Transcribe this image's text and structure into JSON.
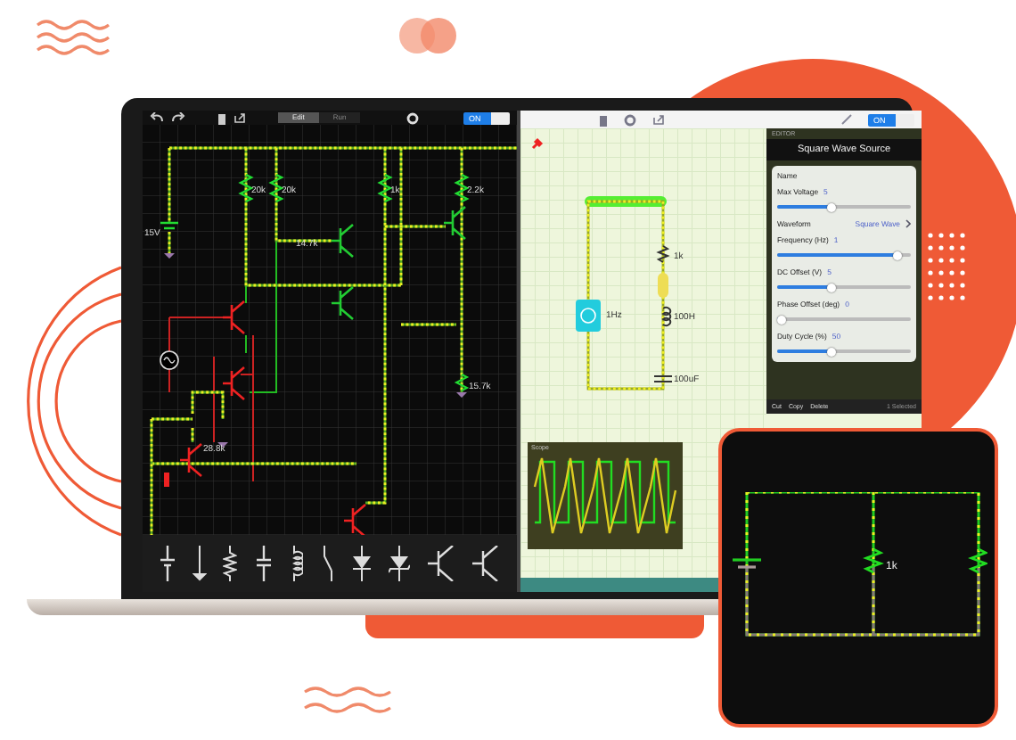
{
  "left_app": {
    "modes": [
      {
        "label": "Edit",
        "selected": true
      },
      {
        "label": "Run",
        "selected": false
      }
    ],
    "power": {
      "label": "ON",
      "on": true
    },
    "component_labels": [
      "20k",
      "20k",
      "1k",
      "2.2k",
      "15V",
      "14.7k",
      "28.8k",
      "15.7k"
    ]
  },
  "right_app": {
    "power": {
      "label": "ON",
      "on": true
    },
    "component_labels": [
      "1k",
      "1Hz",
      "100H",
      "100uF"
    ],
    "scope": {
      "title": "Scope"
    },
    "editor": {
      "header": "EDITOR",
      "title": "Square Wave Source",
      "fields": [
        {
          "kind": "text",
          "label": "Name"
        },
        {
          "kind": "slider",
          "label": "Max Voltage",
          "value": "5",
          "level": 0.4
        },
        {
          "kind": "link",
          "label": "Waveform",
          "value": "Square Wave"
        },
        {
          "kind": "slider",
          "label": "Frequency (Hz)",
          "value": "1",
          "level": 0.9
        },
        {
          "kind": "slider",
          "label": "DC Offset (V)",
          "value": "5",
          "level": 0.4
        },
        {
          "kind": "slider",
          "label": "Phase Offset (deg)",
          "value": "0",
          "level": 0.03
        },
        {
          "kind": "slider",
          "label": "Duty Cycle (%)",
          "value": "50",
          "level": 0.4
        }
      ],
      "actions": [
        "Cut",
        "Copy",
        "Delete"
      ],
      "selection": "1 Selected"
    }
  },
  "inset": {
    "component_labels": [
      "1k"
    ]
  }
}
